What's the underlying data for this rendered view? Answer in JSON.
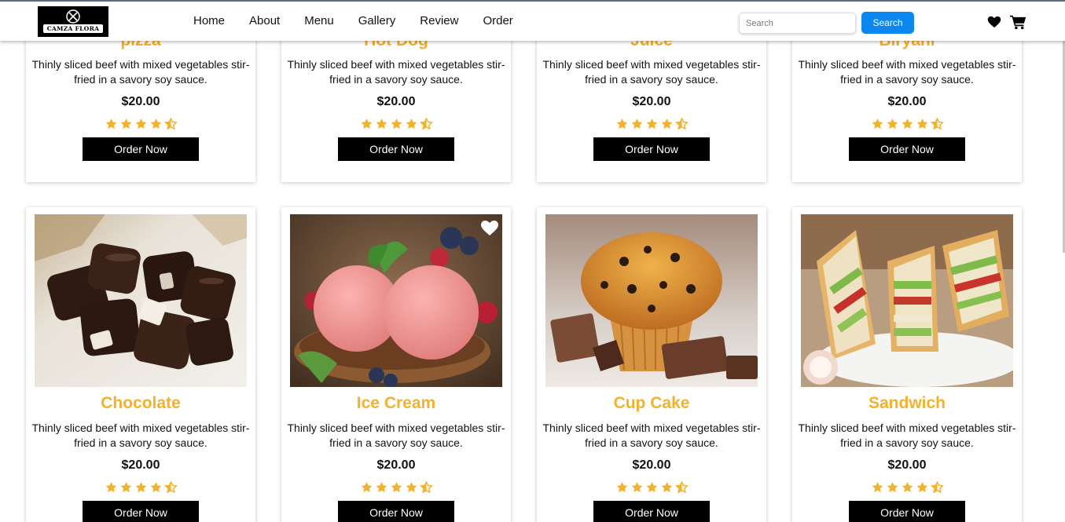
{
  "brand": {
    "name": "CAMZA FLORA"
  },
  "nav": {
    "links": [
      "Home",
      "About",
      "Menu",
      "Gallery",
      "Review",
      "Order"
    ],
    "search_placeholder": "Search",
    "search_button": "Search",
    "icons": [
      "heart-icon",
      "cart-icon"
    ]
  },
  "colors": {
    "accent": "#f3b12c",
    "search_button": "#0d87f0",
    "button": "#000000"
  },
  "rows": [
    {
      "cards": [
        {
          "name": "pizza",
          "description": "Thinly sliced beef with mixed vegetables stir-fried in a savory soy sauce.",
          "price": "$20.00",
          "rating": 4.5,
          "button": "Order Now"
        },
        {
          "name": "Hot Dog",
          "description": "Thinly sliced beef with mixed vegetables stir-fried in a savory soy sauce.",
          "price": "$20.00",
          "rating": 4.5,
          "button": "Order Now"
        },
        {
          "name": "Juice",
          "description": "Thinly sliced beef with mixed vegetables stir-fried in a savory soy sauce.",
          "price": "$20.00",
          "rating": 4.5,
          "button": "Order Now"
        },
        {
          "name": "Biryani",
          "description": "Thinly sliced beef with mixed vegetables stir-fried in a savory soy sauce.",
          "price": "$20.00",
          "rating": 4.5,
          "button": "Order Now"
        }
      ]
    },
    {
      "cards": [
        {
          "name": "Chocolate",
          "description": "Thinly sliced beef with mixed vegetables stir-fried in a savory soy sauce.",
          "price": "$20.00",
          "rating": 4.5,
          "button": "Order Now",
          "image": "chocolate-pieces"
        },
        {
          "name": "Ice Cream",
          "description": "Thinly sliced beef with mixed vegetables stir-fried in a savory soy sauce.",
          "price": "$20.00",
          "rating": 4.5,
          "button": "Order Now",
          "image": "strawberry-ice-cream",
          "favorite": true
        },
        {
          "name": "Cup Cake",
          "description": "Thinly sliced beef with mixed vegetables stir-fried in a savory soy sauce.",
          "price": "$20.00",
          "rating": 4.5,
          "button": "Order Now",
          "image": "chocolate-chip-muffin"
        },
        {
          "name": "Sandwich",
          "description": "Thinly sliced beef with mixed vegetables stir-fried in a savory soy sauce.",
          "price": "$20.00",
          "rating": 4.5,
          "button": "Order Now",
          "image": "club-sandwich"
        }
      ]
    }
  ]
}
